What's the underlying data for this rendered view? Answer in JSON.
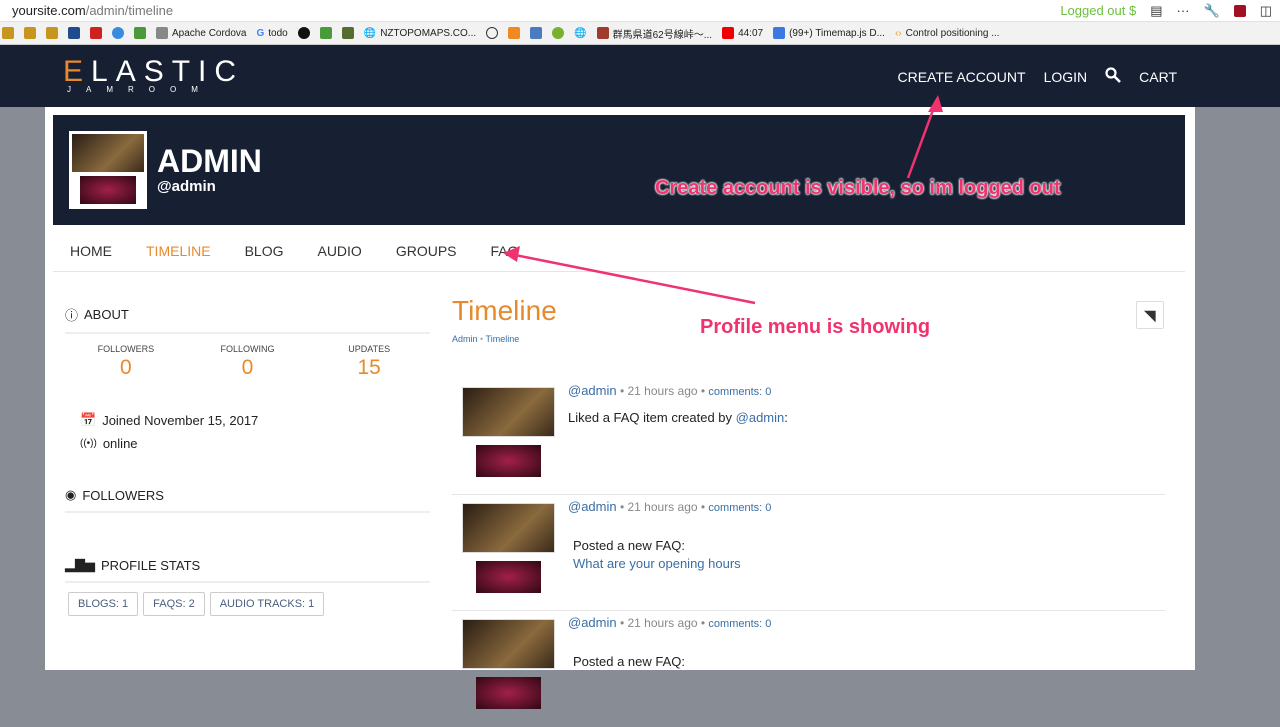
{
  "browser": {
    "url_host": "yoursite.com",
    "url_path": "/admin/timeline",
    "ext_status": "Logged out $",
    "bookmarks": [
      "Apache Cordova",
      "todo",
      "NZTOPOMAPS.CO...",
      "群馬県道62号線峠〜...",
      "44:07",
      "(99+) Timemap.js D...",
      "Control positioning ..."
    ]
  },
  "site": {
    "logo_main": "ELASTIC",
    "logo_sub": "JAMROOM",
    "nav": [
      "CREATE ACCOUNT",
      "LOGIN",
      "CART"
    ]
  },
  "profile": {
    "name": "ADMIN",
    "handle": "@admin",
    "menu": [
      "HOME",
      "TIMELINE",
      "BLOG",
      "AUDIO",
      "GROUPS",
      "FAQ"
    ],
    "active": "TIMELINE"
  },
  "sidebar": {
    "about": "ABOUT",
    "stats": [
      {
        "label": "FOLLOWERS",
        "value": "0"
      },
      {
        "label": "FOLLOWING",
        "value": "0"
      },
      {
        "label": "UPDATES",
        "value": "15"
      }
    ],
    "joined": "Joined November 15, 2017",
    "status": "online",
    "followers": "FOLLOWERS",
    "profile_stats": "PROFILE STATS",
    "stat_buttons": [
      "BLOGS: 1",
      "FAQS: 2",
      "AUDIO TRACKS: 1"
    ]
  },
  "main": {
    "title": "Timeline",
    "breadcrumb": [
      "Admin",
      "Timeline"
    ],
    "items": [
      {
        "user": "@admin",
        "time": "21 hours ago",
        "comments": "comments: 0",
        "text": "Liked a FAQ item created by ",
        "link": "@admin",
        "suffix": ":"
      },
      {
        "user": "@admin",
        "time": "21 hours ago",
        "comments": "comments: 0",
        "text": "Posted a new FAQ:",
        "link": "What are your opening hours",
        "suffix": ""
      },
      {
        "user": "@admin",
        "time": "21 hours ago",
        "comments": "comments: 0",
        "text": "Posted a new FAQ:",
        "link": "",
        "suffix": ""
      }
    ]
  },
  "annotations": {
    "a1": "Create account is visible, so im logged out",
    "a2": "Profile menu is showing"
  },
  "colors": {
    "accent": "#e8892c",
    "dark": "#171f33",
    "annotation": "#f0336e"
  }
}
